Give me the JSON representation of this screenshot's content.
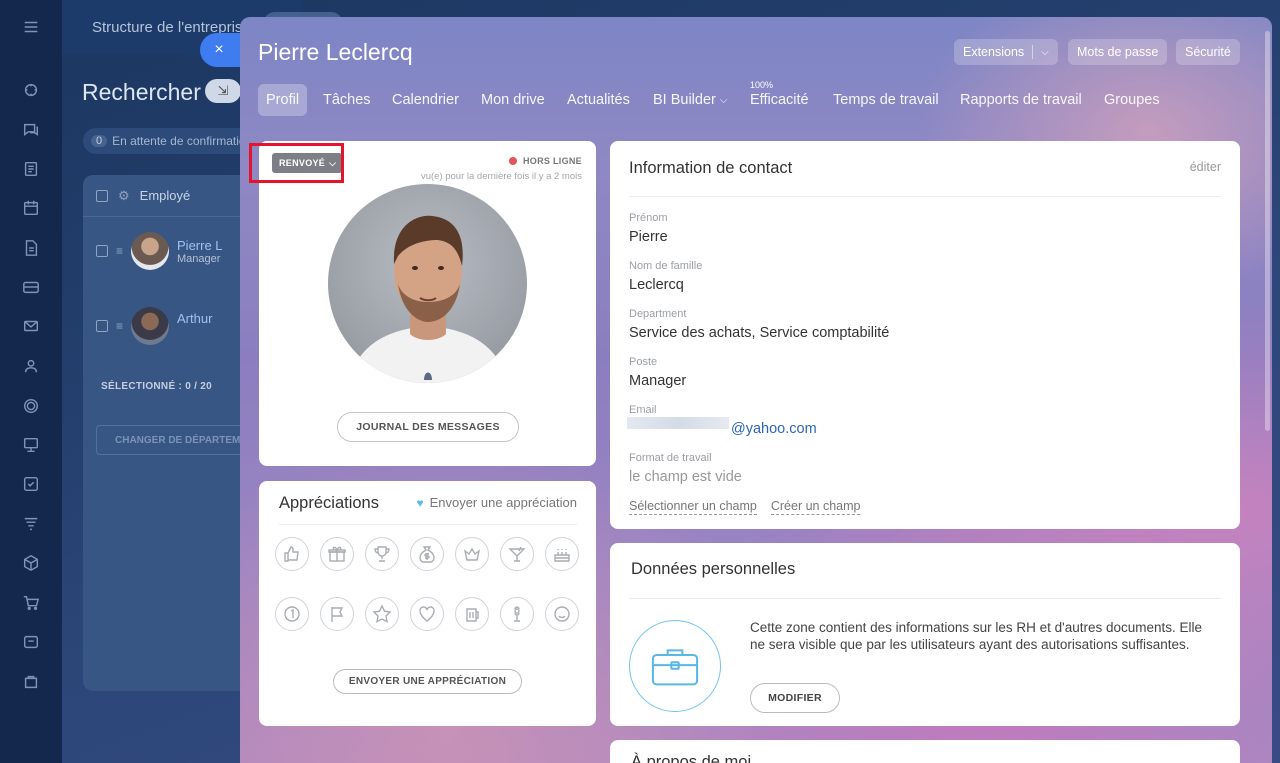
{
  "rail": {
    "icons": [
      "menu-icon",
      "feed-icon",
      "chat-icon",
      "tasks-icon",
      "calendar-icon",
      "document-icon",
      "drive-icon",
      "mail-icon",
      "users-icon",
      "sites-icon",
      "crm-icon",
      "checklist-icon",
      "filter-icon",
      "box-icon",
      "cart-icon",
      "portal-icon",
      "projects-icon"
    ]
  },
  "background": {
    "breadcrumb": "Structure de l'entreprise",
    "search_title": "Rechercher",
    "pending_count": "0",
    "pending_label": "En attente de confirmation",
    "table_header": "Employé",
    "rows": [
      {
        "name": "Pierre L",
        "subtitle": "Manager"
      },
      {
        "name": "Arthur",
        "subtitle": ""
      }
    ],
    "selected": "SÉLECTIONNÉ : 0 / 20",
    "change_dept": "CHANGER DE DÉPARTEMENT"
  },
  "slider": {
    "close_symbol": "×",
    "title": "Pierre Leclercq",
    "header_buttons": {
      "extensions": "Extensions",
      "passwords": "Mots de passe",
      "security": "Sécurité"
    },
    "tabs": [
      {
        "label": "Profil",
        "active": true
      },
      {
        "label": "Tâches"
      },
      {
        "label": "Calendrier"
      },
      {
        "label": "Mon drive"
      },
      {
        "label": "Actualités"
      },
      {
        "label": "BI Builder"
      },
      {
        "label": "Efficacité",
        "badge": "100%"
      },
      {
        "label": "Temps de travail"
      },
      {
        "label": "Rapports de travail"
      },
      {
        "label": "Groupes"
      }
    ]
  },
  "profile": {
    "status_dropdown": "RENVOYÉ",
    "online_status": "HORS LIGNE",
    "last_seen": "vu(e) pour la dernière fois il y a 2 mois",
    "journal_button": "JOURNAL DES MESSAGES",
    "status_color": "#e5535b"
  },
  "appreciations": {
    "title": "Appréciations",
    "send_link": "Envoyer une appréciation",
    "badges": [
      "thumbs-up-icon",
      "gift-icon",
      "trophy-icon",
      "money-bag-icon",
      "crown-icon",
      "cocktail-icon",
      "cake-icon",
      "number-one-icon",
      "flag-icon",
      "star-icon",
      "heart-icon",
      "beer-icon",
      "flower-icon",
      "smile-icon"
    ],
    "send_button": "ENVOYER UNE APPRÉCIATION"
  },
  "contact": {
    "title": "Information de contact",
    "edit": "éditer",
    "fields": {
      "first_name_label": "Prénom",
      "first_name": "Pierre",
      "last_name_label": "Nom de famille",
      "last_name": "Leclercq",
      "department_label": "Department",
      "department": "Service des achats, Service comptabilité",
      "position_label": "Poste",
      "position": "Manager",
      "email_label": "Email",
      "email": "@yahoo.com",
      "work_format_label": "Format de travail",
      "work_format": "le champ est vide"
    },
    "select_field": "Sélectionner un champ",
    "create_field": "Créer un champ"
  },
  "personal": {
    "title": "Données personnelles",
    "description": "Cette zone contient des informations sur les RH et d'autres documents. Elle ne sera visible que par les utilisateurs ayant des autorisations suffisantes.",
    "modify_button": "MODIFIER",
    "accent": "#74c3ea"
  },
  "bottom": {
    "title": "À propos de moi"
  }
}
